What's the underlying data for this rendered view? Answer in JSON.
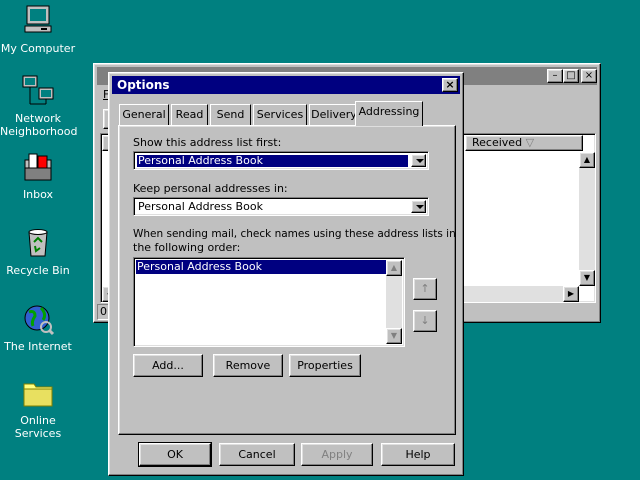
{
  "desktop": {
    "icons": [
      {
        "label": "My Computer",
        "icon": "computer-icon"
      },
      {
        "label": "Network Neighborhood",
        "icon": "network-icon"
      },
      {
        "label": "Inbox",
        "icon": "inbox-icon"
      },
      {
        "label": "Recycle Bin",
        "icon": "recycle-bin-icon"
      },
      {
        "label": "The Internet",
        "icon": "internet-icon"
      },
      {
        "label": "Online Services",
        "icon": "folder-icon"
      }
    ]
  },
  "background_window": {
    "menu_letter": "F",
    "column_received": "Received",
    "status_count": "0"
  },
  "dialog": {
    "title": "Options",
    "tabs": [
      "General",
      "Read",
      "Send",
      "Services",
      "Delivery",
      "Addressing"
    ],
    "active_tab": "Addressing",
    "show_first_label": "Show this address list first:",
    "show_first_value": "Personal Address Book",
    "keep_label": "Keep personal addresses in:",
    "keep_value": "Personal Address Book",
    "order_label_line1": "When sending mail, check names using these address lists in",
    "order_label_line2": "the following order:",
    "order_list": [
      "Personal Address Book"
    ],
    "add_label": "Add...",
    "remove_label": "Remove",
    "properties_label": "Properties",
    "ok_label": "OK",
    "cancel_label": "Cancel",
    "apply_label": "Apply",
    "help_label": "Help"
  },
  "colors": {
    "desktop": "#008080",
    "title_active": "#000080",
    "title_inactive": "#808080",
    "face": "#c0c0c0"
  }
}
